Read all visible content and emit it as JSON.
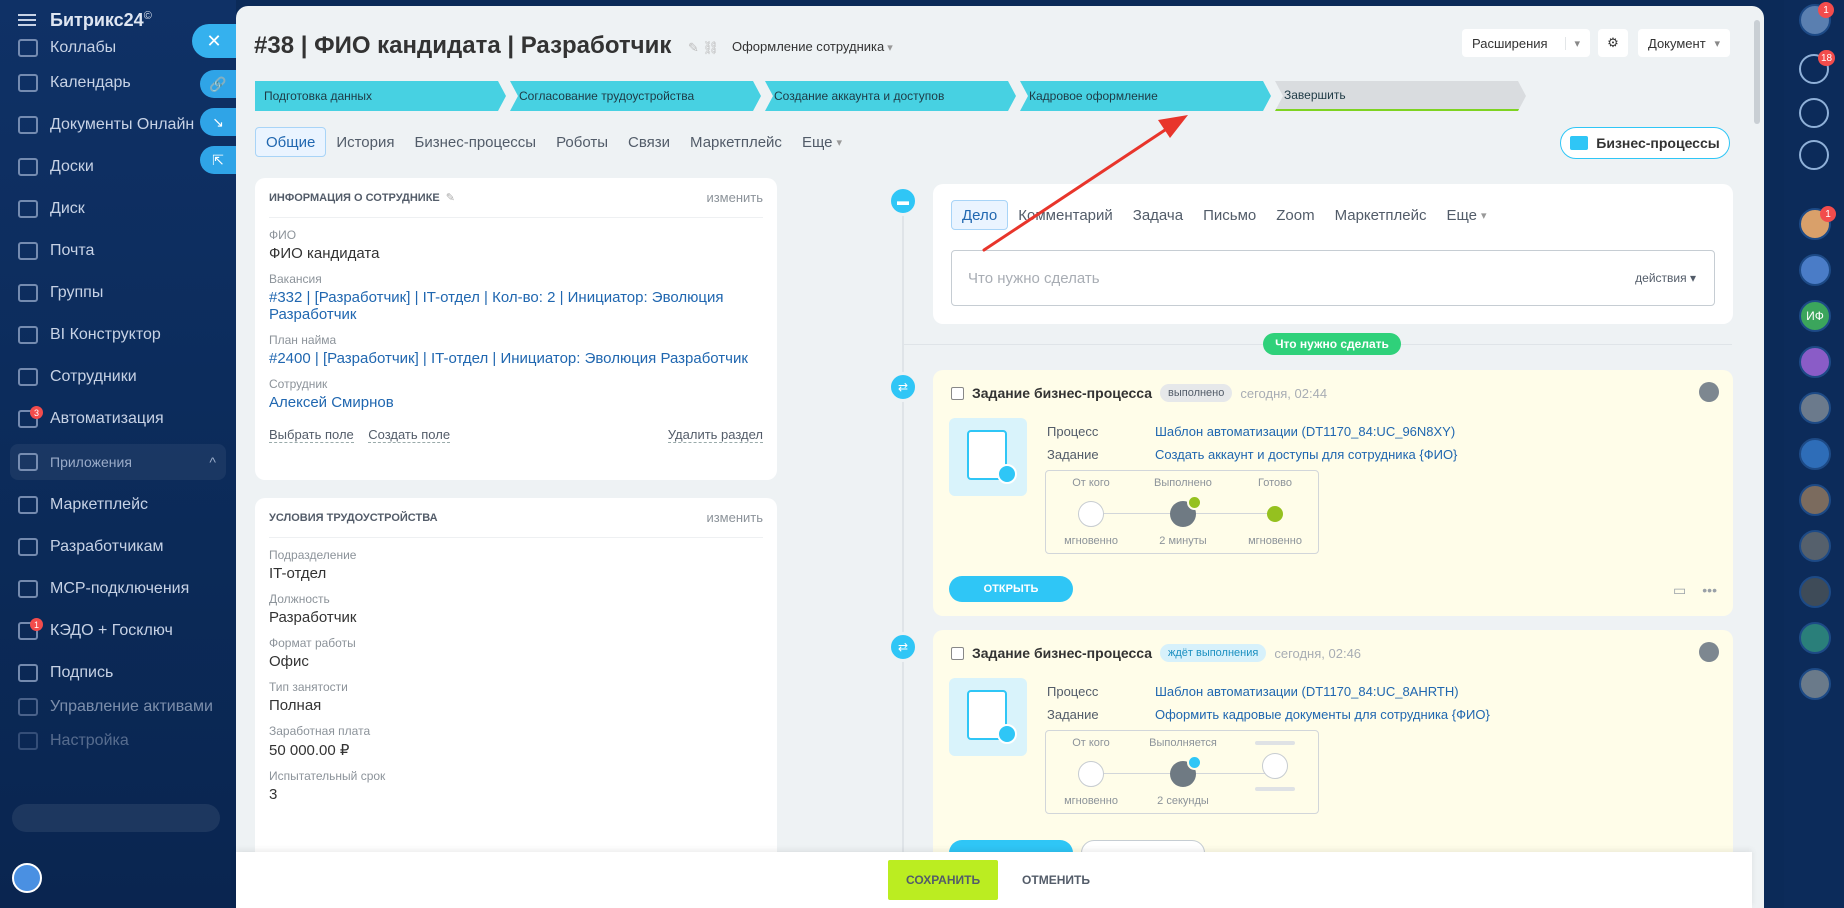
{
  "sidebar": {
    "logo": "Битрикс24",
    "logo_mark": "©",
    "items": [
      {
        "label": "Коллабы"
      },
      {
        "label": "Календарь"
      },
      {
        "label": "Документы Онлайн"
      },
      {
        "label": "Доски"
      },
      {
        "label": "Диск"
      },
      {
        "label": "Почта"
      },
      {
        "label": "Группы"
      },
      {
        "label": "BI Конструктор"
      },
      {
        "label": "Сотрудники"
      },
      {
        "label": "Автоматизация",
        "badge": "3"
      }
    ],
    "section_label": "Приложения",
    "items2": [
      {
        "label": "Маркетплейс"
      },
      {
        "label": "Разработчикам"
      },
      {
        "label": "МСР-подключения"
      },
      {
        "label": "КЭДО + Госключ",
        "badge": "1"
      },
      {
        "label": "Подпись"
      },
      {
        "label": "Управление активами"
      },
      {
        "label": "Настройка"
      }
    ]
  },
  "rightbar": {
    "user_badge": "1",
    "notif_badge": "18",
    "chat_badge": "1",
    "initials": "ИФ"
  },
  "header": {
    "title": "#38 | ФИО кандидата | Разработчик",
    "pipeline": "Оформление сотрудника",
    "extensions_label": "Расширения",
    "document_label": "Документ"
  },
  "stages": [
    {
      "label": "Подготовка данных"
    },
    {
      "label": "Согласование трудоустройства"
    },
    {
      "label": "Создание аккаунта и доступов"
    },
    {
      "label": "Кадровое оформление"
    },
    {
      "label": "Завершить"
    }
  ],
  "tabs": [
    {
      "label": "Общие"
    },
    {
      "label": "История"
    },
    {
      "label": "Бизнес-процессы"
    },
    {
      "label": "Роботы"
    },
    {
      "label": "Связи"
    },
    {
      "label": "Маркетплейс"
    },
    {
      "label": "Еще"
    }
  ],
  "bp_button": "Бизнес-процессы",
  "employee_card": {
    "title": "ИНФОРМАЦИЯ О СОТРУДНИКЕ",
    "edit": "изменить",
    "fields": [
      {
        "label": "ФИО",
        "value": "ФИО кандидата"
      },
      {
        "label": "Вакансия",
        "value": "#332 | [Разработчик] | IT-отдел | Кол-во: 2 | Инициатор: Эволюция Разработчик"
      },
      {
        "label": "План найма",
        "value": "#2400 | [Разработчик] | IT-отдел | Инициатор: Эволюция Разработчик"
      },
      {
        "label": "Сотрудник",
        "value": "Алексей Смирнов"
      }
    ],
    "select_field": "Выбрать поле",
    "create_field": "Создать поле",
    "delete_section": "Удалить раздел"
  },
  "conditions_card": {
    "title": "УСЛОВИЯ ТРУДОУСТРОЙСТВА",
    "edit": "изменить",
    "fields": [
      {
        "label": "Подразделение",
        "value": "IT-отдел"
      },
      {
        "label": "Должность",
        "value": "Разработчик"
      },
      {
        "label": "Формат работы",
        "value": "Офис"
      },
      {
        "label": "Тип занятости",
        "value": "Полная"
      },
      {
        "label": "Заработная плата",
        "value": "50 000.00 ₽"
      },
      {
        "label": "Испытательный срок",
        "value": "3"
      }
    ]
  },
  "editor": {
    "tabs": [
      {
        "label": "Дело"
      },
      {
        "label": "Комментарий"
      },
      {
        "label": "Задача"
      },
      {
        "label": "Письмо"
      },
      {
        "label": "Zoom"
      },
      {
        "label": "Маркетплейс"
      },
      {
        "label": "Еще"
      }
    ],
    "placeholder": "Что нужно сделать",
    "actions": "действия"
  },
  "todo_pill": "Что нужно сделать",
  "tasks": [
    {
      "title": "Задание бизнес-процесса",
      "status": "выполнено",
      "time": "сегодня, 02:44",
      "process_label": "Процесс",
      "process": "Шаблон автоматизации (DT1170_84:UC_96N8XY)",
      "task_label": "Задание",
      "task": "Создать аккаунт и доступы для сотрудника {ФИО}",
      "flow": [
        {
          "head": "От кого",
          "foot": "мгновенно"
        },
        {
          "head": "Выполнено",
          "foot": "2 минуты"
        },
        {
          "head": "Готово",
          "foot": "мгновенно"
        }
      ],
      "button": "ОТКРЫТЬ"
    },
    {
      "title": "Задание бизнес-процесса",
      "status": "ждёт выполнения",
      "time": "сегодня, 02:46",
      "process_label": "Процесс",
      "process": "Шаблон автоматизации (DT1170_84:UC_8AHRTH)",
      "task_label": "Задание",
      "task": "Оформить кадровые документы для сотрудника {ФИО}",
      "flow": [
        {
          "head": "От кого",
          "foot": "мгновенно"
        },
        {
          "head": "Выполняется",
          "foot": "2 секунды"
        },
        {
          "head": "",
          "foot": ""
        }
      ]
    }
  ],
  "footer": {
    "save": "СОХРАНИТЬ",
    "cancel": "ОТМЕНИТЬ"
  },
  "colors": {
    "stage_active": "#47d1e2",
    "accent": "#2fc6f6",
    "save": "#bbed21",
    "annotation_arrow": "#e8352b"
  }
}
